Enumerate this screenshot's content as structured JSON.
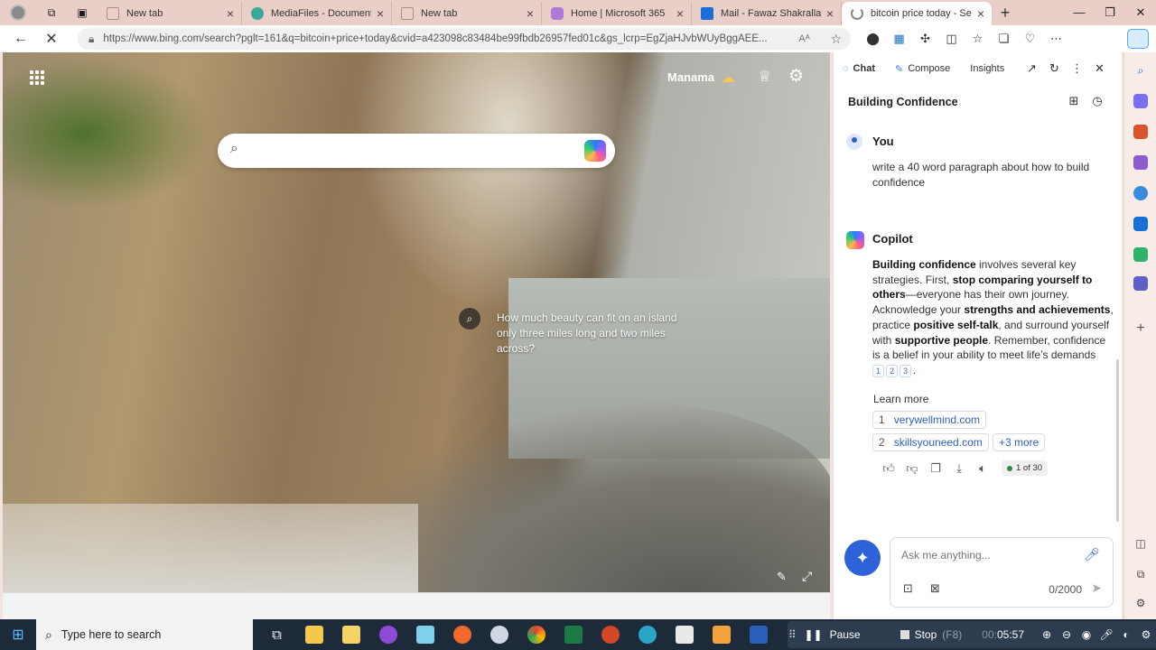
{
  "browser": {
    "tabs": [
      {
        "title": "New tab",
        "favicon_color": "#c9a29a",
        "active": false
      },
      {
        "title": "MediaFiles - Documents",
        "favicon_color": "#3aa89a",
        "active": false
      },
      {
        "title": "New tab",
        "favicon_color": "#c9a29a",
        "active": false
      },
      {
        "title": "Home | Microsoft 365",
        "favicon_color": "#b07ad8",
        "active": false
      },
      {
        "title": "Mail - Fawaz Shakralla - (",
        "favicon_color": "#1a6fd6",
        "active": false
      },
      {
        "title": "bitcoin price today - Sear",
        "favicon_color": "#ffffff",
        "active": true
      }
    ],
    "new_tab_label": "+",
    "url": "https://www.bing.com/search?pglt=161&q=bitcoin+price+today&cvid=a423098c83484be99fbdb26957fed01c&gs_lcrp=EgZjaHJvbWUyBggAEE...",
    "read_aloud_label": "Aᴬ"
  },
  "bing": {
    "location": "Manama",
    "search_placeholder": "",
    "trivia": "How much beauty can fit on an island only three miles long and two miles across?"
  },
  "copilot": {
    "tabs": [
      {
        "label": "Chat",
        "icon": "chat-icon"
      },
      {
        "label": "Compose",
        "icon": "compose-icon"
      },
      {
        "label": "Insights",
        "icon": ""
      }
    ],
    "conversation_title": "Building Confidence",
    "user_name": "You",
    "user_message": "write a 40 word paragraph about how to build confidence",
    "bot_name": "Copilot",
    "bot_segments": [
      {
        "text": "Building confidence",
        "bold": true
      },
      {
        "text": " involves several key strategies. First, ",
        "bold": false
      },
      {
        "text": "stop comparing yourself to others",
        "bold": true
      },
      {
        "text": "—everyone has their own journey. Acknowledge your ",
        "bold": false
      },
      {
        "text": "strengths and achievements",
        "bold": true
      },
      {
        "text": ", practice ",
        "bold": false
      },
      {
        "text": "positive self-talk",
        "bold": true
      },
      {
        "text": ", and surround yourself with ",
        "bold": false
      },
      {
        "text": "supportive people",
        "bold": true
      },
      {
        "text": ". Remember, confidence is a belief in your ability to meet life’s demands",
        "bold": false
      }
    ],
    "citations": [
      "1",
      "2",
      "3"
    ],
    "learn_more_label": "Learn more",
    "links": [
      {
        "num": "1",
        "text": "verywellmind.com"
      },
      {
        "num": "2",
        "text": "skillsyouneed.com"
      }
    ],
    "more_label": "+3 more",
    "response_count": "1 of 30",
    "input_placeholder": "Ask me anything...",
    "char_count": "0/2000"
  },
  "taskbar": {
    "search_text": "Type here to search",
    "recorder": {
      "pause_label": "Pause",
      "stop_label": "Stop",
      "stop_key": "(F8)",
      "time_prefix": "00:",
      "time": "05:57"
    }
  }
}
